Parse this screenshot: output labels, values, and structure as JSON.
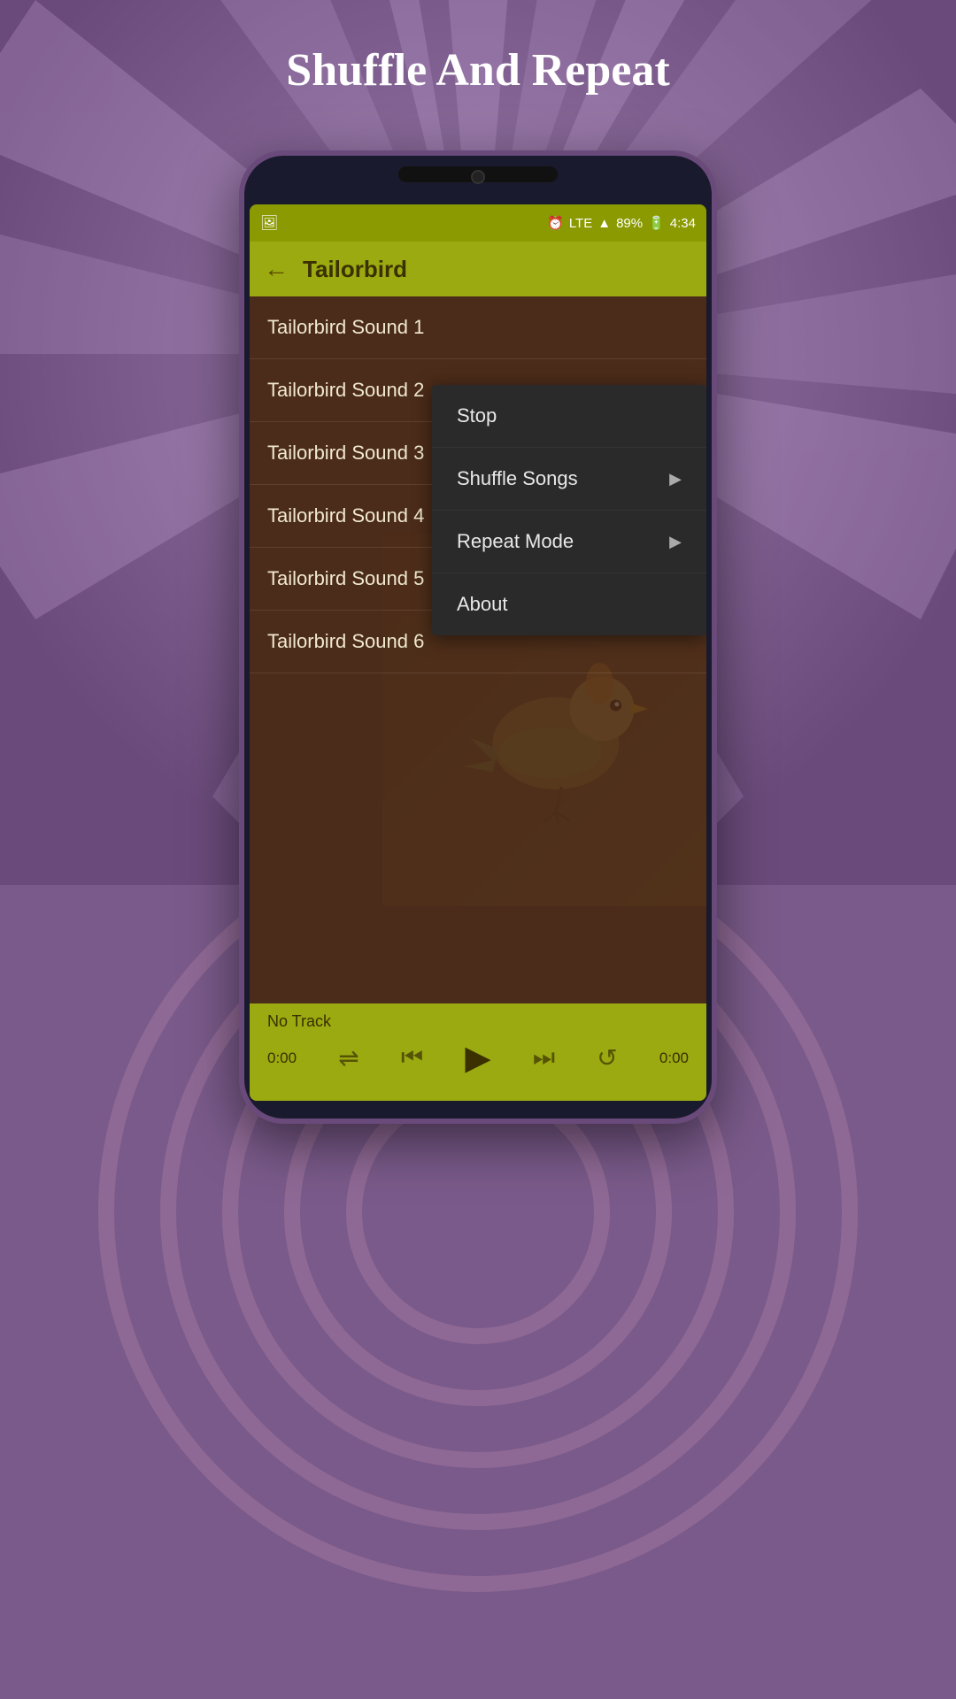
{
  "page": {
    "title": "Shuffle And Repeat"
  },
  "status_bar": {
    "battery": "89%",
    "time": "4:34",
    "signal": "LTE"
  },
  "toolbar": {
    "title": "Tailorbird",
    "back_label": "←"
  },
  "songs": [
    {
      "id": 1,
      "label": "Tailorbird Sound 1"
    },
    {
      "id": 2,
      "label": "Tailorbird Sound 2"
    },
    {
      "id": 3,
      "label": "Tailorbird Sound 3"
    },
    {
      "id": 4,
      "label": "Tailorbird Sound 4"
    },
    {
      "id": 5,
      "label": "Tailorbird Sound 5"
    },
    {
      "id": 6,
      "label": "Tailorbird Sound 6"
    }
  ],
  "player": {
    "track": "No Track",
    "time_left": "0:00",
    "time_right": "0:00"
  },
  "menu": {
    "items": [
      {
        "id": "stop",
        "label": "Stop",
        "has_submenu": false
      },
      {
        "id": "shuffle",
        "label": "Shuffle Songs",
        "has_submenu": true
      },
      {
        "id": "repeat",
        "label": "Repeat Mode",
        "has_submenu": true
      },
      {
        "id": "about",
        "label": "About",
        "has_submenu": false
      }
    ]
  }
}
